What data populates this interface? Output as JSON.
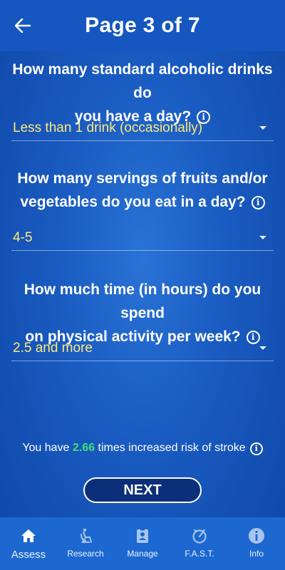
{
  "header": {
    "title": "Page 3 of 7",
    "back_icon": "arrow-left-icon"
  },
  "questions": [
    {
      "text_line1": "How many standard alcoholic drinks do",
      "text_line2": "you have a day?",
      "selected": "Less than 1 drink (occasionally)"
    },
    {
      "text_line1": "How many servings of fruits and/or",
      "text_line2": "vegetables do you eat in a day?",
      "selected": "4-5"
    },
    {
      "text_line1": "How much time (in hours) do you spend",
      "text_line2": "on physical activity per week?",
      "selected": "2.5 and more"
    }
  ],
  "risk": {
    "prefix": "You have ",
    "value": "2.66",
    "suffix": " times increased risk of stroke",
    "value_color": "#3ee07c"
  },
  "next_label": "NEXT",
  "nav": [
    {
      "label": "Assess",
      "icon": "home-icon",
      "active": true
    },
    {
      "label": "Research",
      "icon": "research-icon",
      "active": false
    },
    {
      "label": "Manage",
      "icon": "manage-icon",
      "active": false
    },
    {
      "label": "F.A.S.T.",
      "icon": "fast-icon",
      "active": false
    },
    {
      "label": "Info",
      "icon": "info-icon",
      "active": false
    }
  ],
  "colors": {
    "accent_text": "#ffe97a",
    "app_bar": "#1556c0",
    "nav_bar": "#1c68d0"
  }
}
